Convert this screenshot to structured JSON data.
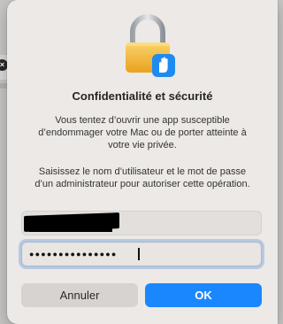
{
  "dialog": {
    "title": "Confidentialité et sécurité",
    "message": "Vous tentez d’ouvrir une app susceptible d’endommager votre Mac ou de porter atteinte à votre vie privée.",
    "instruction": "Saisissez le nom d’utilisateur et le mot de passe d’un administrateur pour autoriser cette opération.",
    "username": {
      "value": "",
      "redacted": true
    },
    "password": {
      "masked_value": "●●●●●●●●●●●●●●●",
      "focused": true
    },
    "buttons": {
      "cancel": "Annuler",
      "ok": "OK"
    },
    "icon": "padlock-with-hand-icon"
  },
  "colors": {
    "accent": "#1b87ff",
    "dialog_bg": "#ece9e6",
    "lock_gold": "#f0b429",
    "badge_blue": "#1e8bf0"
  }
}
